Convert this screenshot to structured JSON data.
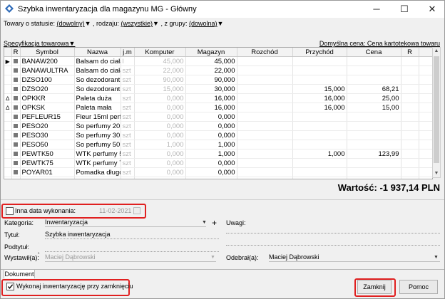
{
  "window": {
    "title": "Szybka inwentaryzacja dla magazynu MG - Główny"
  },
  "filters": {
    "status_label": "Towary o statusie:",
    "status_value": "(dowolny)",
    "type_label": ", rodzaju:",
    "type_value": "(wszystkie)",
    "group_label": ", z grupy:",
    "group_value": "(dowolna)"
  },
  "spec_label": "Specyfikacja towarowa",
  "default_price": "Domyślna cena: Cena kartotekowa towaru",
  "table": {
    "columns": [
      "R",
      "Symbol",
      "Nazwa",
      "j.m",
      "Komputer",
      "Magazyn",
      "Rozchód",
      "Przychód",
      "Cena",
      "R"
    ],
    "rows": [
      {
        "ind": "▶",
        "symbol": "BANAW200",
        "nazwa": "Balsam do ciała",
        "jm": "l",
        "komputer": "45,000",
        "magazyn": "45,000",
        "rozchod": "",
        "przychod": "",
        "cena": ""
      },
      {
        "ind": "",
        "symbol": "BANAWULTRA",
        "nazwa": "Balsam do ciała",
        "jm": "szt",
        "komputer": "22,000",
        "magazyn": "22,000",
        "rozchod": "",
        "przychod": "",
        "cena": ""
      },
      {
        "ind": "",
        "symbol": "DZSO100",
        "nazwa": "So dezodorant",
        "jm": "szt",
        "komputer": "90,000",
        "magazyn": "90,000",
        "rozchod": "",
        "przychod": "",
        "cena": ""
      },
      {
        "ind": "",
        "symbol": "DZSO20",
        "nazwa": "So dezodorant",
        "jm": "szt",
        "komputer": "15,000",
        "magazyn": "30,000",
        "rozchod": "",
        "przychod": "15,000",
        "cena": "68,21"
      },
      {
        "ind": "∆",
        "symbol": "OPKKR",
        "nazwa": "Paleta duża",
        "jm": "szt",
        "komputer": "0,000",
        "magazyn": "16,000",
        "rozchod": "",
        "przychod": "16,000",
        "cena": "25,00"
      },
      {
        "ind": "∆",
        "symbol": "OPKSK",
        "nazwa": "Paleta mała",
        "jm": "szt",
        "komputer": "0,000",
        "magazyn": "16,000",
        "rozchod": "",
        "przychod": "16,000",
        "cena": "15,00"
      },
      {
        "ind": "",
        "symbol": "PEFLEUR15",
        "nazwa": "Fleur 15ml perfu",
        "jm": "szt",
        "komputer": "0,000",
        "magazyn": "0,000",
        "rozchod": "",
        "przychod": "",
        "cena": ""
      },
      {
        "ind": "",
        "symbol": "PESO20",
        "nazwa": "So perfumy 20",
        "jm": "szt",
        "komputer": "0,000",
        "magazyn": "0,000",
        "rozchod": "",
        "przychod": "",
        "cena": ""
      },
      {
        "ind": "",
        "symbol": "PESO30",
        "nazwa": "So perfumy 30",
        "jm": "szt",
        "komputer": "0,000",
        "magazyn": "0,000",
        "rozchod": "",
        "przychod": "",
        "cena": ""
      },
      {
        "ind": "",
        "symbol": "PESO50",
        "nazwa": "So perfumy 50",
        "jm": "szt",
        "komputer": "1,000",
        "magazyn": "1,000",
        "rozchod": "",
        "przychod": "",
        "cena": ""
      },
      {
        "ind": "",
        "symbol": "PEWTK50",
        "nazwa": "WTK perfumy 5",
        "jm": "szt",
        "komputer": "0,000",
        "magazyn": "1,000",
        "rozchod": "",
        "przychod": "1,000",
        "cena": "123,99"
      },
      {
        "ind": "",
        "symbol": "PEWTK75",
        "nazwa": "WTK perfumy 7",
        "jm": "szt",
        "komputer": "0,000",
        "magazyn": "0,000",
        "rozchod": "",
        "przychod": "",
        "cena": ""
      },
      {
        "ind": "",
        "symbol": "POYAR01",
        "nazwa": "Pomadka długot",
        "jm": "szt",
        "komputer": "0,000",
        "magazyn": "0,000",
        "rozchod": "",
        "przychod": "",
        "cena": ""
      }
    ]
  },
  "total": "Wartość: -1 937,14 PLN",
  "form": {
    "other_date_label": "Inna data wykonania:",
    "other_date_checked": false,
    "date_value": "11-02-2021",
    "kategoria_label": "Kategoria:",
    "kategoria_value": "Inwentaryzacja",
    "uwagi_label": "Uwagi:",
    "tytul_label": "Tytuł:",
    "tytul_value": "Szybka inwentaryzacja",
    "podtytul_label": "Podtytuł:",
    "wystawil_label": "Wystawił(a):",
    "wystawil_value": "Maciej Dąbrowski",
    "odebral_label": "Odebrał(a):",
    "odebral_value": "Maciej Dąbrowski"
  },
  "tabs": [
    "Dokument"
  ],
  "footer": {
    "execute_label": "Wykonaj inwentaryzację przy zamknięciu",
    "execute_checked": true,
    "close_button": "Zamknij",
    "help_button": "Pomoc"
  },
  "colors": {
    "highlight": "#e02020",
    "gray_text": "#b5b5b5"
  }
}
